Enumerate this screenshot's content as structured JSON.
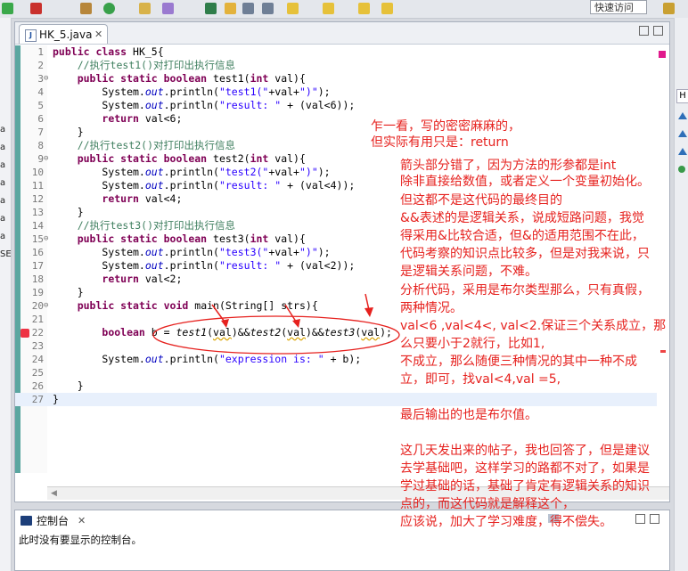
{
  "toolbar": {
    "quick_access": "快速访问"
  },
  "editor": {
    "tab_title": "HK_5.java",
    "lines": [
      {
        "n": "1",
        "fold": "",
        "cur": false,
        "segs": [
          [
            "kw",
            "public class "
          ],
          [
            "",
            "HK_5{"
          ]
        ]
      },
      {
        "n": "2",
        "fold": "",
        "cur": false,
        "segs": [
          [
            "",
            "    "
          ],
          [
            "cm",
            "//执行test1()对打印出执行信息"
          ]
        ]
      },
      {
        "n": "3",
        "fold": "⊖",
        "cur": false,
        "segs": [
          [
            "",
            "    "
          ],
          [
            "kw",
            "public static boolean "
          ],
          [
            "",
            "test1("
          ],
          [
            "kw",
            "int "
          ],
          [
            "",
            "val){"
          ]
        ]
      },
      {
        "n": "4",
        "fold": "",
        "cur": false,
        "segs": [
          [
            "",
            "        System."
          ],
          [
            "fd",
            "out"
          ],
          [
            "",
            ".println("
          ],
          [
            "st",
            "\"test1(\""
          ],
          [
            "",
            "+val+"
          ],
          [
            "st",
            "\")\""
          ],
          [
            "",
            ");"
          ]
        ]
      },
      {
        "n": "5",
        "fold": "",
        "cur": false,
        "segs": [
          [
            "",
            "        System."
          ],
          [
            "fd",
            "out"
          ],
          [
            "",
            ".println("
          ],
          [
            "st",
            "\"result: \""
          ],
          [
            "",
            " + (val<6));"
          ]
        ]
      },
      {
        "n": "6",
        "fold": "",
        "cur": false,
        "segs": [
          [
            "",
            "        "
          ],
          [
            "kw",
            "return "
          ],
          [
            "",
            "val<6;"
          ]
        ]
      },
      {
        "n": "7",
        "fold": "",
        "cur": false,
        "segs": [
          [
            "",
            "    }"
          ]
        ]
      },
      {
        "n": "8",
        "fold": "",
        "cur": false,
        "segs": [
          [
            "",
            "    "
          ],
          [
            "cm",
            "//执行test2()对打印出执行信息"
          ]
        ]
      },
      {
        "n": "9",
        "fold": "⊖",
        "cur": false,
        "segs": [
          [
            "",
            "    "
          ],
          [
            "kw",
            "public static boolean "
          ],
          [
            "",
            "test2("
          ],
          [
            "kw",
            "int "
          ],
          [
            "",
            "val){"
          ]
        ]
      },
      {
        "n": "10",
        "fold": "",
        "cur": false,
        "segs": [
          [
            "",
            "        System."
          ],
          [
            "fd",
            "out"
          ],
          [
            "",
            ".println("
          ],
          [
            "st",
            "\"test2(\""
          ],
          [
            "",
            "+val+"
          ],
          [
            "st",
            "\")\""
          ],
          [
            "",
            ");"
          ]
        ]
      },
      {
        "n": "11",
        "fold": "",
        "cur": false,
        "segs": [
          [
            "",
            "        System."
          ],
          [
            "fd",
            "out"
          ],
          [
            "",
            ".println("
          ],
          [
            "st",
            "\"result: \""
          ],
          [
            "",
            " + (val<4));"
          ]
        ]
      },
      {
        "n": "12",
        "fold": "",
        "cur": false,
        "segs": [
          [
            "",
            "        "
          ],
          [
            "kw",
            "return "
          ],
          [
            "",
            "val<4;"
          ]
        ]
      },
      {
        "n": "13",
        "fold": "",
        "cur": false,
        "segs": [
          [
            "",
            "    }"
          ]
        ]
      },
      {
        "n": "14",
        "fold": "",
        "cur": false,
        "segs": [
          [
            "",
            "    "
          ],
          [
            "cm",
            "//执行test3()对打印出执行信息"
          ]
        ]
      },
      {
        "n": "15",
        "fold": "⊖",
        "cur": false,
        "segs": [
          [
            "",
            "    "
          ],
          [
            "kw",
            "public static boolean "
          ],
          [
            "",
            "test3("
          ],
          [
            "kw",
            "int "
          ],
          [
            "",
            "val){"
          ]
        ]
      },
      {
        "n": "16",
        "fold": "",
        "cur": false,
        "segs": [
          [
            "",
            "        System."
          ],
          [
            "fd",
            "out"
          ],
          [
            "",
            ".println("
          ],
          [
            "st",
            "\"test3(\""
          ],
          [
            "",
            "+val+"
          ],
          [
            "st",
            "\")\""
          ],
          [
            "",
            ");"
          ]
        ]
      },
      {
        "n": "17",
        "fold": "",
        "cur": false,
        "segs": [
          [
            "",
            "        System."
          ],
          [
            "fd",
            "out"
          ],
          [
            "",
            ".println("
          ],
          [
            "st",
            "\"result: \""
          ],
          [
            "",
            " + (val<2));"
          ]
        ]
      },
      {
        "n": "18",
        "fold": "",
        "cur": false,
        "segs": [
          [
            "",
            "        "
          ],
          [
            "kw",
            "return "
          ],
          [
            "",
            "val<2;"
          ]
        ]
      },
      {
        "n": "19",
        "fold": "",
        "cur": false,
        "segs": [
          [
            "",
            "    }"
          ]
        ]
      },
      {
        "n": "20",
        "fold": "⊖",
        "cur": false,
        "segs": [
          [
            "",
            "    "
          ],
          [
            "kw",
            "public static void "
          ],
          [
            "",
            "main(String[] strs){"
          ]
        ]
      },
      {
        "n": "21",
        "fold": "",
        "cur": false,
        "segs": [
          [
            "",
            ""
          ]
        ]
      },
      {
        "n": "22",
        "fold": "",
        "cur": false,
        "segs": [
          [
            "",
            "        "
          ],
          [
            "kw",
            "boolean "
          ],
          [
            "",
            "b = "
          ],
          [
            "it",
            "test1"
          ],
          [
            "",
            "("
          ],
          [
            "ul",
            "val"
          ],
          [
            "",
            ")&&"
          ],
          [
            "it",
            "test2"
          ],
          [
            "",
            "("
          ],
          [
            "ul",
            "val"
          ],
          [
            "",
            ")&&"
          ],
          [
            "it",
            "test3"
          ],
          [
            "",
            "("
          ],
          [
            "ul",
            "val"
          ],
          [
            "",
            ");"
          ]
        ]
      },
      {
        "n": "23",
        "fold": "",
        "cur": false,
        "segs": [
          [
            "",
            ""
          ]
        ]
      },
      {
        "n": "24",
        "fold": "",
        "cur": false,
        "segs": [
          [
            "",
            "        System."
          ],
          [
            "fd",
            "out"
          ],
          [
            "",
            ".println("
          ],
          [
            "st",
            "\"expression is: \""
          ],
          [
            "",
            " + b);"
          ]
        ]
      },
      {
        "n": "25",
        "fold": "",
        "cur": false,
        "segs": [
          [
            "",
            ""
          ]
        ]
      },
      {
        "n": "26",
        "fold": "",
        "cur": false,
        "segs": [
          [
            "",
            "    }"
          ]
        ]
      },
      {
        "n": "27",
        "fold": "",
        "cur": true,
        "segs": [
          [
            "",
            "}"
          ]
        ]
      }
    ]
  },
  "console": {
    "tab_title": "控制台",
    "message": "此时没有要显示的控制台。"
  },
  "annotations": [
    "乍一看，写的密密麻麻的，",
    "但实际有用只是：return",
    "箭头部分错了，因为方法的形参都是int",
    "除非直接给数值，或者定义一个变量初始化。",
    "但这都不是这代码的最终目的",
    "&&表述的是逻辑关系，说成短路问题，我觉",
    "得采用&比较合适，但&的适用范围不在此，",
    "代码考察的知识点比较多，但是对我来说，只",
    "是逻辑关系问题，不难。",
    "分析代码，采用是布尔类型那么，只有真假，",
    "两种情况。",
    "val<6 ,val<4<, val<2.保证三个关系成立，那",
    "么只要小于2就行，比如1,",
    "不成立，那么随便三种情况的其中一种不成",
    "立，即可，找val<4,val =5,",
    "",
    "最后输出的也是布尔值。",
    "",
    "这几天发出来的帖子，我也回答了，但是建议",
    "去学基础吧，这样学习的路都不对了，如果是",
    "学过基础的话，基础了肯定有逻辑关系的知识",
    "点的，而这代码就是解释这个，",
    "应该说，加大了学习难度，得不偿失。"
  ],
  "colors": {
    "annotation": "#e6211e",
    "keyword": "#7f0055",
    "string": "#2a00ff",
    "comment": "#3f7f5f"
  }
}
